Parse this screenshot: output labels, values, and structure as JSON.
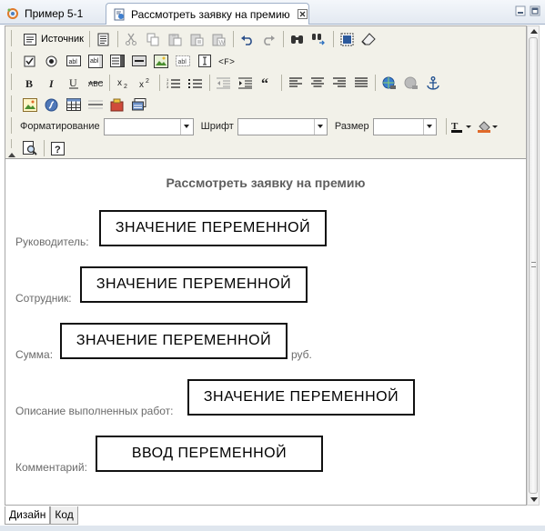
{
  "tabs": [
    {
      "label": "Пример 5-1"
    },
    {
      "label": "Рассмотреть заявку на премию"
    }
  ],
  "toolbar": {
    "source_label": "Источник",
    "format_label": "Форматирование",
    "format_value": "",
    "font_label": "Шрифт",
    "font_value": "",
    "size_label": "Размер",
    "size_value": ""
  },
  "content": {
    "title": "Рассмотреть заявку на премию",
    "fields": [
      {
        "label": "Руководитель:",
        "value": "ЗНАЧЕНИЕ ПЕРЕМЕННОЙ"
      },
      {
        "label": "Сотрудник:",
        "value": "ЗНАЧЕНИЕ ПЕРЕМЕННОЙ"
      },
      {
        "label": "Сумма:",
        "value": "ЗНАЧЕНИЕ ПЕРЕМЕННОЙ",
        "unit": "руб."
      },
      {
        "label": "Описание выполненных работ:",
        "value": "ЗНАЧЕНИЕ ПЕРЕМЕННОЙ"
      },
      {
        "label": "Комментарий:",
        "value": "ВВОД ПЕРЕМЕННОЙ"
      }
    ]
  },
  "bottom_tabs": [
    {
      "label": "Дизайн"
    },
    {
      "label": "Код"
    }
  ],
  "icons": [
    "process-icon",
    "web-page-icon",
    "close-icon",
    "minimize-icon",
    "maximize-icon",
    "source-icon",
    "document-icon",
    "cut-icon",
    "copy-icon",
    "paste-icon",
    "paste-text-icon",
    "paste-word-icon",
    "undo-icon",
    "redo-icon",
    "find-icon",
    "replace-icon",
    "select-all-icon",
    "remove-format-icon",
    "checkbox-icon",
    "radio-icon",
    "textfield-icon",
    "textarea-icon",
    "select-field-icon",
    "button-icon",
    "image-button-icon",
    "hidden-field-icon",
    "text-cursor-icon",
    "code-tag-icon",
    "bold-icon",
    "italic-icon",
    "strike-icon",
    "subscript-icon",
    "superscript-icon",
    "ordered-list-icon",
    "unordered-list-icon",
    "outdent-icon",
    "indent-icon",
    "blockquote-icon",
    "align-left-icon",
    "align-center-icon",
    "align-right-icon",
    "justify-icon",
    "link-icon",
    "unlink-icon",
    "anchor-icon",
    "image-icon",
    "flash-icon",
    "table-icon",
    "horizontal-rule-icon",
    "smiley-icon",
    "special-char-icon",
    "text-color-icon",
    "bg-color-icon",
    "preview-icon",
    "help-icon"
  ]
}
